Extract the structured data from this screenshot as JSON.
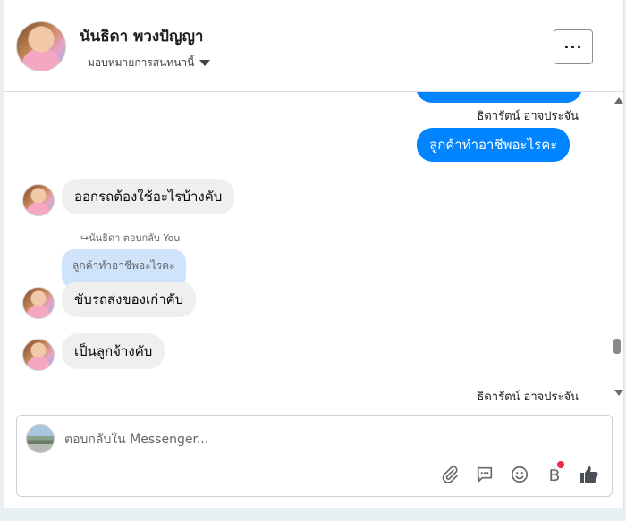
{
  "header": {
    "name": "นันธิดา พวงปัญญา",
    "assign_label": "มอบหมายการสนทนานี้",
    "more_label": "···"
  },
  "messages": {
    "sender_top": "ธิดารัตน์ อาจประจัน",
    "out_message": "ลูกค้าทำอาชีพอะไรคะ",
    "in_message_1": "ออกรถต้องใช้อะไรบ้างคับ",
    "reply_ref": "นันธิดา ตอบกลับ You",
    "quoted_text": "ลูกค้าทำอาชีพอะไรคะ",
    "in_message_2": "ขับรถส่งของเก่าคับ",
    "in_message_3": "เป็นลูกจ้างคับ",
    "sender_bottom": "ธิดารัตน์ อาจประจัน"
  },
  "composer": {
    "placeholder": "ตอบกลับใน Messenger...",
    "currency_symbol": "฿"
  },
  "colors": {
    "outgoing_bubble": "#0084ff",
    "incoming_bubble": "#efefef",
    "quoted_bubble": "#cfe3fb",
    "notification_dot": "#f02849"
  }
}
